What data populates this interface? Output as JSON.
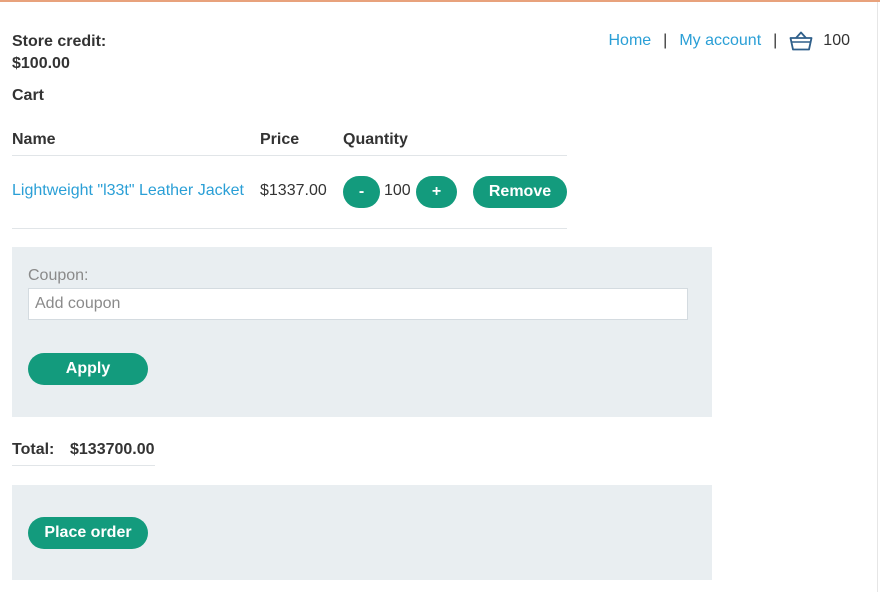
{
  "header": {
    "store_credit_label": "Store credit:",
    "store_credit_value": "$100.00",
    "nav": {
      "home": "Home",
      "separator": "|",
      "my_account": "My account",
      "cart_count": "100"
    },
    "basket_icon": "basket-icon"
  },
  "cart": {
    "heading": "Cart",
    "columns": [
      "Name",
      "Price",
      "Quantity"
    ],
    "items": [
      {
        "name": "Lightweight \"l33t\" Leather Jacket",
        "price": "$1337.00",
        "quantity": "100",
        "decrement_label": "-",
        "increment_label": "+",
        "remove_label": "Remove"
      }
    ]
  },
  "coupon": {
    "label": "Coupon:",
    "placeholder": "Add coupon",
    "apply_label": "Apply"
  },
  "total": {
    "label": "Total:",
    "value": "$133700.00"
  },
  "order": {
    "place_order_label": "Place order"
  },
  "colors": {
    "accent": "#139b7d",
    "link": "#2a9fd6",
    "panel": "#e9eef1",
    "top_rule": "#e8a27c"
  }
}
